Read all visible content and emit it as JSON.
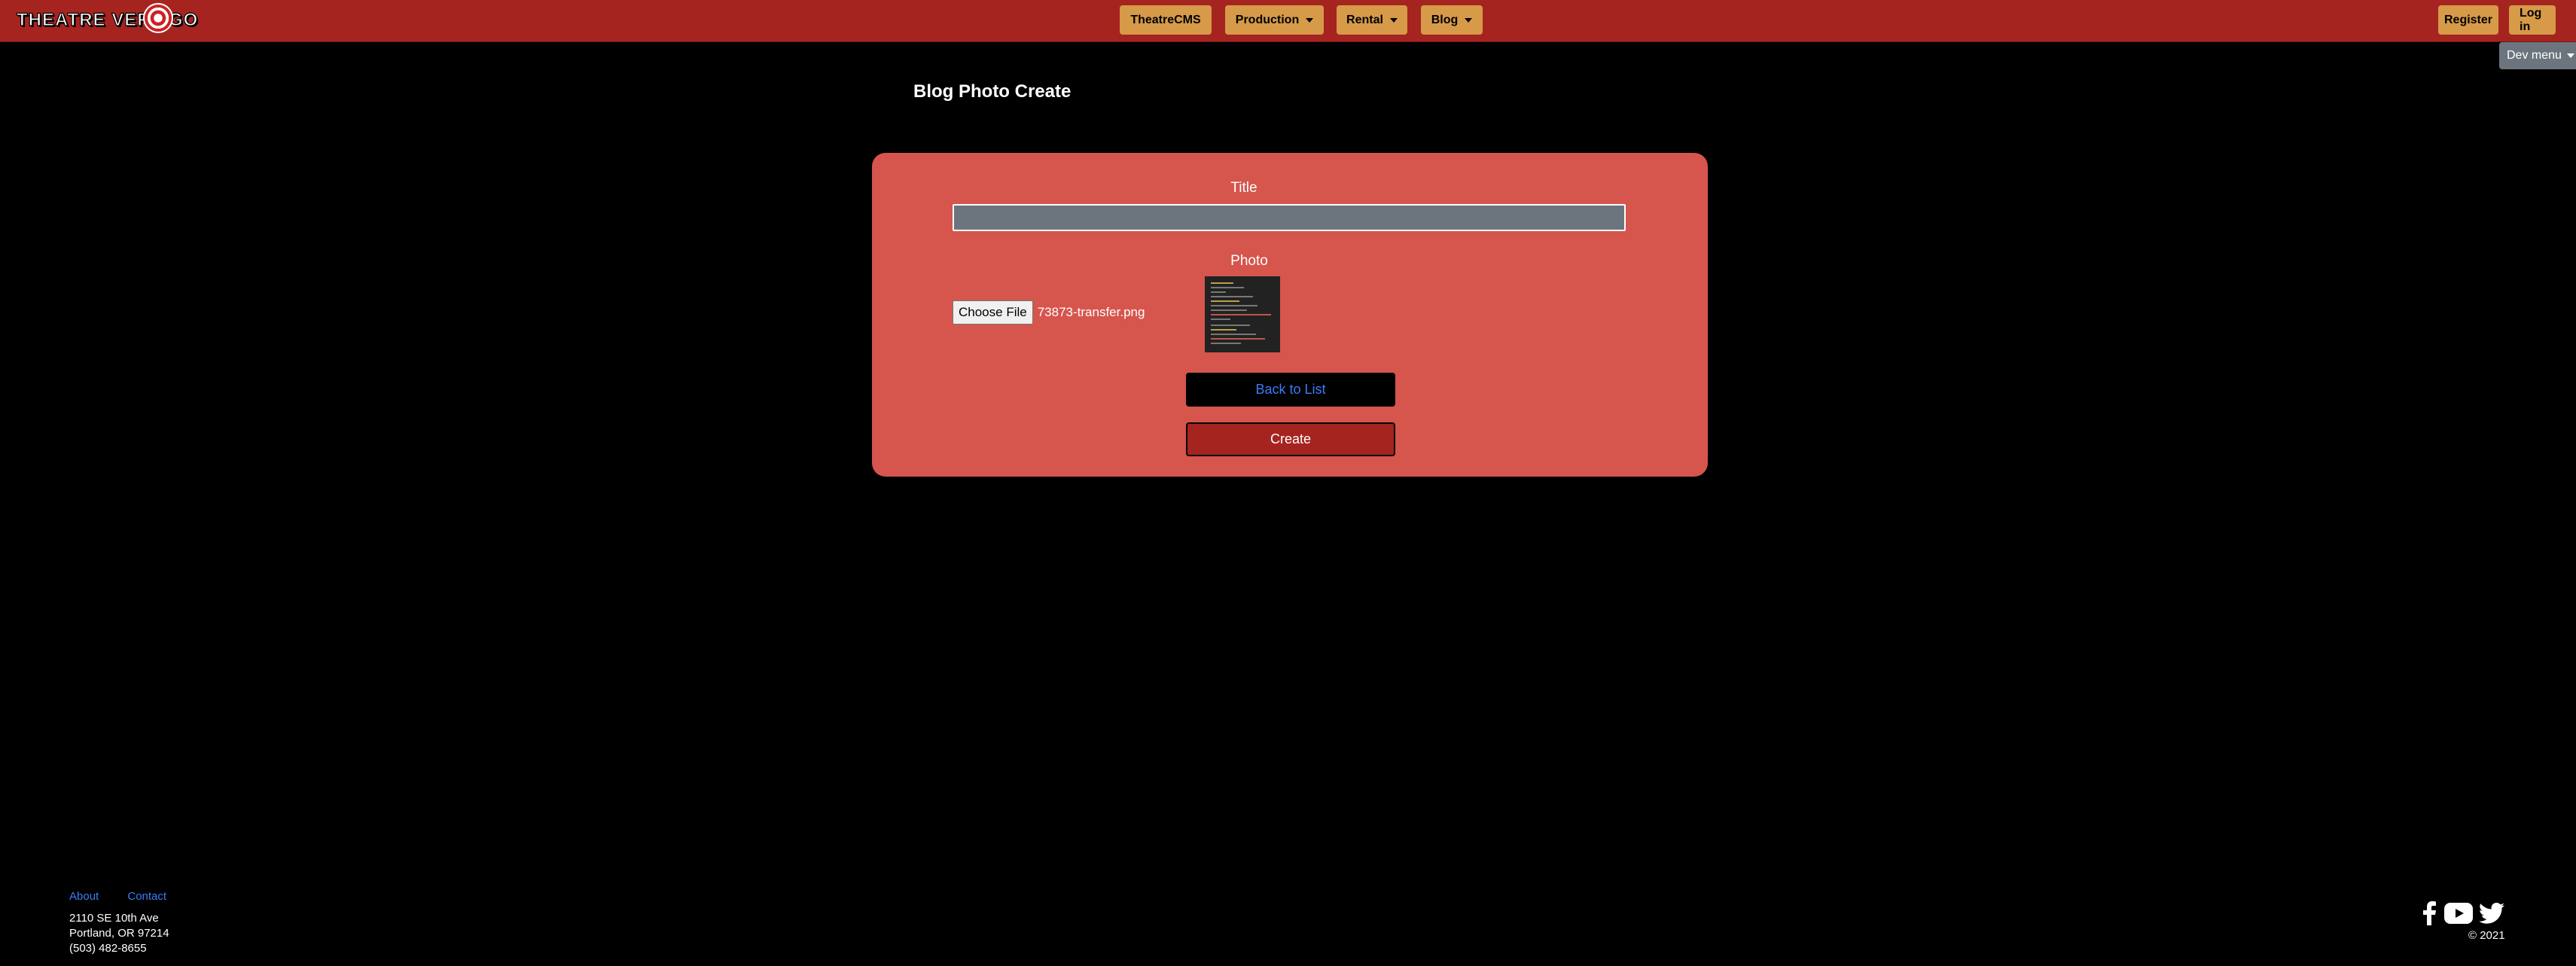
{
  "nav": {
    "brand": "THEATRE VERTIGO",
    "items": [
      {
        "label": "TheatreCMS",
        "dropdown": false
      },
      {
        "label": "Production",
        "dropdown": true
      },
      {
        "label": "Rental",
        "dropdown": true
      },
      {
        "label": "Blog",
        "dropdown": true
      }
    ],
    "register": "Register",
    "login": "Log in",
    "dev_menu": "Dev menu"
  },
  "page": {
    "title": "Blog Photo Create"
  },
  "form": {
    "title_label": "Title",
    "title_value": "",
    "photo_label": "Photo",
    "choose_file": "Choose File",
    "file_name": "73873-transfer.png",
    "back_label": "Back to List",
    "create_label": "Create"
  },
  "footer": {
    "links": [
      "About",
      "Contact"
    ],
    "address_line1": "2110 SE 10th Ave",
    "address_line2": "Portland, OR 97214",
    "phone": "(503) 482-8655",
    "copyright": "© 2021",
    "social_icons": [
      "facebook-icon",
      "youtube-icon",
      "twitter-icon"
    ]
  },
  "colors": {
    "navbar": "#a52420",
    "nav_button": "#d69a49",
    "card": "#d6554c",
    "link": "#3d7cf5",
    "background": "#000000"
  }
}
